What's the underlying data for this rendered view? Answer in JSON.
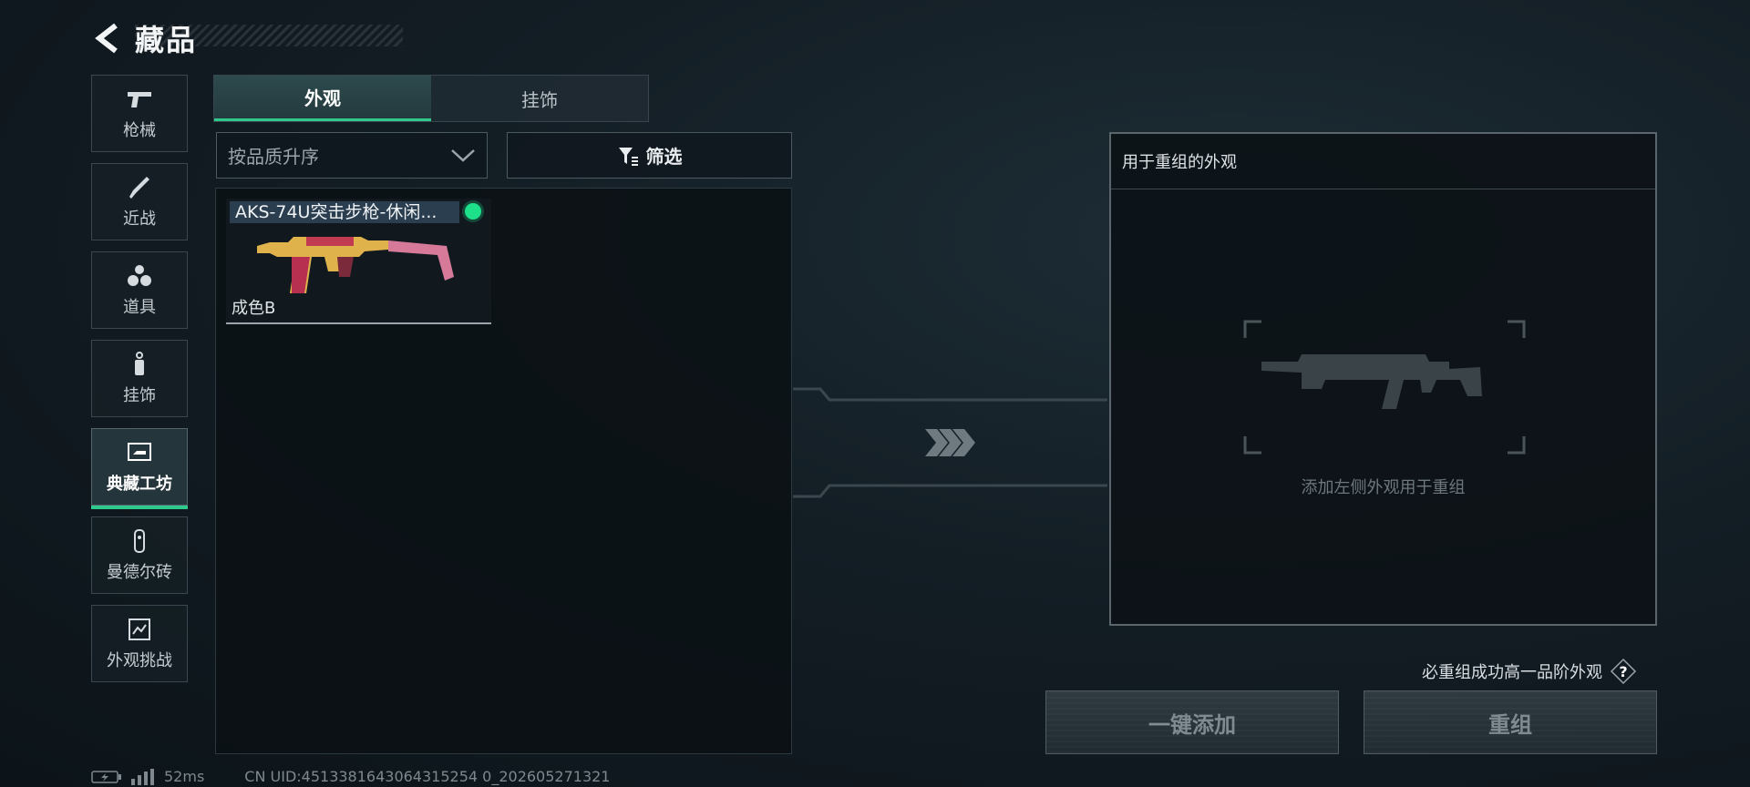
{
  "header": {
    "title": "藏品"
  },
  "sidebar": {
    "items": [
      {
        "label": "枪械",
        "icon": "pistol-icon"
      },
      {
        "label": "近战",
        "icon": "knife-icon"
      },
      {
        "label": "道具",
        "icon": "grenades-icon"
      },
      {
        "label": "挂饰",
        "icon": "charm-icon"
      },
      {
        "label": "典藏工坊",
        "icon": "workshop-icon",
        "active": true
      },
      {
        "label": "曼德尔砖",
        "icon": "brick-icon"
      },
      {
        "label": "外观挑战",
        "icon": "challenge-icon"
      }
    ]
  },
  "tabs": [
    {
      "label": "外观",
      "active": true
    },
    {
      "label": "挂饰",
      "active": false
    }
  ],
  "sort": {
    "label": "按品质升序"
  },
  "filter": {
    "label": "筛选"
  },
  "items": [
    {
      "name": "AKS-74U突击步枪-休闲...",
      "grade": "成色B",
      "status_color": "#1fe08a"
    }
  ],
  "right_panel": {
    "title": "用于重组的外观",
    "placeholder": "添加左侧外观用于重组"
  },
  "guarantee": {
    "text": "必重组成功高一品阶外观",
    "icon": "help-icon"
  },
  "buttons": {
    "add_all": "一键添加",
    "recombine": "重组"
  },
  "status": {
    "ping": "52ms",
    "uid": "CN UID:4513381643064315254 0_202605271321"
  },
  "colors": {
    "accent": "#2fc88d",
    "status_dot": "#1fe08a"
  }
}
